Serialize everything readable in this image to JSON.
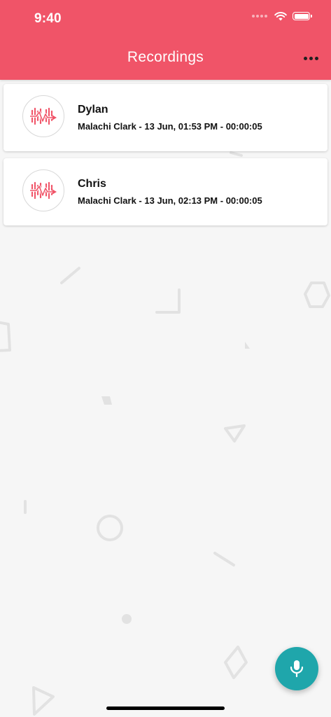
{
  "status_bar": {
    "time": "9:40",
    "icons": [
      "signal-dots-icon",
      "wifi-icon",
      "battery-icon"
    ]
  },
  "header": {
    "title": "Recordings",
    "more_icon": "more-horizontal-icon"
  },
  "recordings": [
    {
      "name": "Dylan",
      "meta": "Malachi Clark - 13 Jun, 01:53 PM - 00:00:05",
      "icon": "audio-waveform-icon"
    },
    {
      "name": "Chris",
      "meta": "Malachi Clark - 13 Jun, 02:13 PM - 00:00:05",
      "icon": "audio-waveform-icon"
    }
  ],
  "fab": {
    "icon": "microphone-icon"
  },
  "colors": {
    "header": "#f05468",
    "accent_icon": "#f05468",
    "fab": "#1fa6ab",
    "background": "#f6f6f6"
  }
}
